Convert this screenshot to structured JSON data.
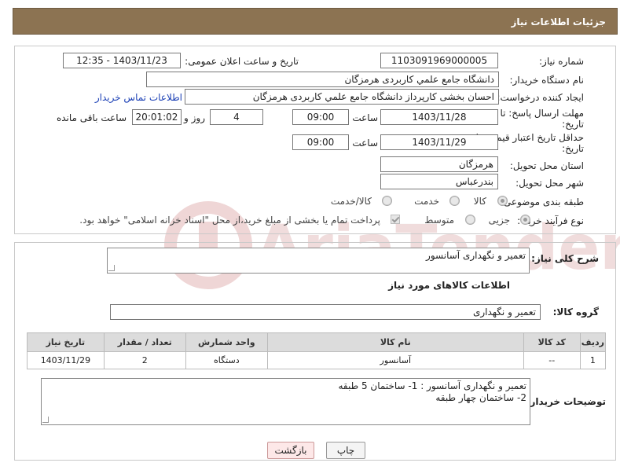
{
  "header": {
    "title": "جزئیات اطلاعات نیاز"
  },
  "form": {
    "need_number_label": "شماره نیاز:",
    "need_number": "1103091969000005",
    "announce_label": "تاریخ و ساعت اعلان عمومی:",
    "announce_value": "1403/11/23 - 12:35",
    "buyer_org_label": "نام دستگاه خریدار:",
    "buyer_org": "دانشگاه جامع علمي كاربردی هرمزگان",
    "creator_label": "ایجاد کننده درخواست:",
    "creator": "احسان بخشی کارپرداز دانشگاه جامع علمي كاربردی هرمزگان",
    "contact_link": "اطلاعات تماس خریدار",
    "deadline_label_1": "مهلت ارسال پاسخ: تا",
    "deadline_label_2": "تاریخ:",
    "deadline_date": "1403/11/28",
    "time_label": "ساعت",
    "deadline_time": "09:00",
    "days_value": "4",
    "days_label": "روز و",
    "remaining_time": "20:01:02",
    "remaining_label": "ساعت باقی مانده",
    "price_label_1": "حداقل تاریخ اعتبار قیمت: تا",
    "price_label_2": "تاریخ:",
    "price_date": "1403/11/29",
    "price_time": "09:00",
    "province_label": "استان محل تحویل:",
    "province": "هرمزگان",
    "city_label": "شهر محل تحویل:",
    "city": "بندرعباس",
    "category_label": "طبقه بندی موضوعی:",
    "category_options": [
      "کالا",
      "خدمت",
      "کالا/خدمت"
    ],
    "process_label": "نوع فرآیند خرید :",
    "process_options": [
      "جزیی",
      "متوسط"
    ],
    "payment_note": "پرداخت تمام یا بخشی از مبلغ خرید،از محل \"اسناد خزانه اسلامی\" خواهد بود."
  },
  "summary": {
    "label": "شرح کلی نیاز:",
    "value": "تعمیر و نگهداری آسانسور"
  },
  "goods": {
    "section_title": "اطلاعات کالاهای مورد نیاز",
    "group_label": "گروه کالا:",
    "group_value": "تعمیر و نگهداری",
    "columns": [
      "ردیف",
      "کد کالا",
      "نام کالا",
      "واحد شمارش",
      "تعداد / مقدار",
      "تاریخ نیاز"
    ],
    "rows": [
      [
        "1",
        "--",
        "آسانسور",
        "دستگاه",
        "2",
        "1403/11/29"
      ]
    ]
  },
  "buyer_notes": {
    "label": "توضیحات خریدار:",
    "value": "تعمیر و نگهداری آسانسور : 1- ساختمان 5 طبقه\n2- ساختمان چهار طبقه"
  },
  "buttons": {
    "print": "چاپ",
    "back": "بازگشت"
  },
  "watermark": {
    "text": "AriaTender.neT"
  },
  "colors": {
    "header_bg": "#8c7352",
    "link": "#1a3fb5",
    "back_button_bg": "#fde8e8"
  }
}
